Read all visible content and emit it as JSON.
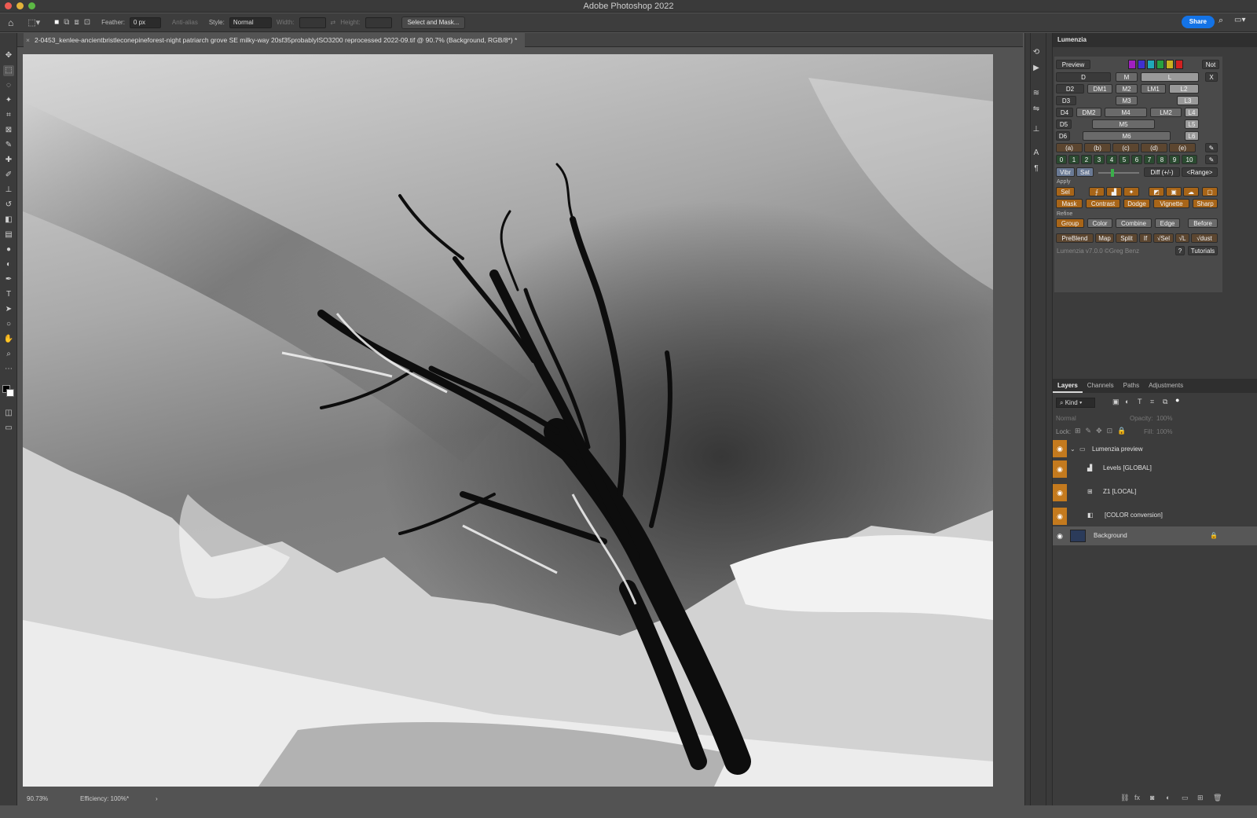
{
  "app": {
    "title": "Adobe Photoshop 2022",
    "share_label": "Share"
  },
  "options": {
    "feather_label": "Feather:",
    "feather_value": "0 px",
    "antialias_label": "Anti-alias",
    "style_label": "Style:",
    "style_value": "Normal",
    "width_label": "Width:",
    "height_label": "Height:",
    "select_mask_label": "Select and Mask..."
  },
  "document": {
    "tab_title": "2-0453_kenlee-ancientbristleconepineforest-night patriarch grove SE milky-way 20sf35probablyISO3200 reprocessed 2022-09.tif @ 90.7% (Background, RGB/8*) *",
    "zoom": "90.73%",
    "efficiency": "Efficiency: 100%*"
  },
  "lumenzia": {
    "title": "Lumenzia",
    "preview": "Preview",
    "not": "Not",
    "x": "X",
    "rows": [
      [
        "D",
        "M",
        "L"
      ],
      [
        "D2",
        "DM1",
        "M2",
        "LM1",
        "L2"
      ],
      [
        "D3",
        "M3",
        "L3"
      ],
      [
        "D4",
        "DM2",
        "M4",
        "LM2",
        "L4"
      ],
      [
        "D5",
        "M5",
        "L5"
      ],
      [
        "D6",
        "M6",
        "L6"
      ]
    ],
    "zones": [
      "(a)",
      "(b)",
      "(c)",
      "(d)",
      "(e)"
    ],
    "numbers": [
      "0",
      "1",
      "2",
      "3",
      "4",
      "5",
      "6",
      "7",
      "8",
      "9",
      "10"
    ],
    "vibr": "Vibr",
    "sat": "Sat",
    "diff": "Diff (+/-)",
    "range": "<Range>",
    "apply_label": "Apply",
    "sel": "Sel",
    "apply_row": [
      "Mask",
      "Contrast",
      "Dodge",
      "Vignette",
      "Sharp"
    ],
    "refine_label": "Refine",
    "refine_row": [
      "Group",
      "Color",
      "Combine",
      "Edge",
      "Before"
    ],
    "bottom_row": [
      "PreBlend",
      "Map",
      "Split",
      "If",
      "√Sel",
      "√L",
      "√dust"
    ],
    "version": "Lumenzia v7.0.0 ©Greg Benz",
    "help": "?",
    "tutorials": "Tutorials"
  },
  "layers_panel": {
    "tabs": [
      "Layers",
      "Channels",
      "Paths",
      "Adjustments"
    ],
    "kind": "Kind",
    "blend": "Normal",
    "opacity_label": "Opacity:",
    "opacity_value": "100%",
    "lock_label": "Lock:",
    "fill_label": "Fill:",
    "fill_value": "100%",
    "layers": [
      {
        "name": "Lumenzia preview"
      },
      {
        "name": "Levels [GLOBAL]"
      },
      {
        "name": "Z1 [LOCAL]"
      },
      {
        "name": "[COLOR conversion]"
      },
      {
        "name": "Background"
      }
    ]
  },
  "colors": {
    "accent": "#c47a1e",
    "share": "#1473e6"
  }
}
